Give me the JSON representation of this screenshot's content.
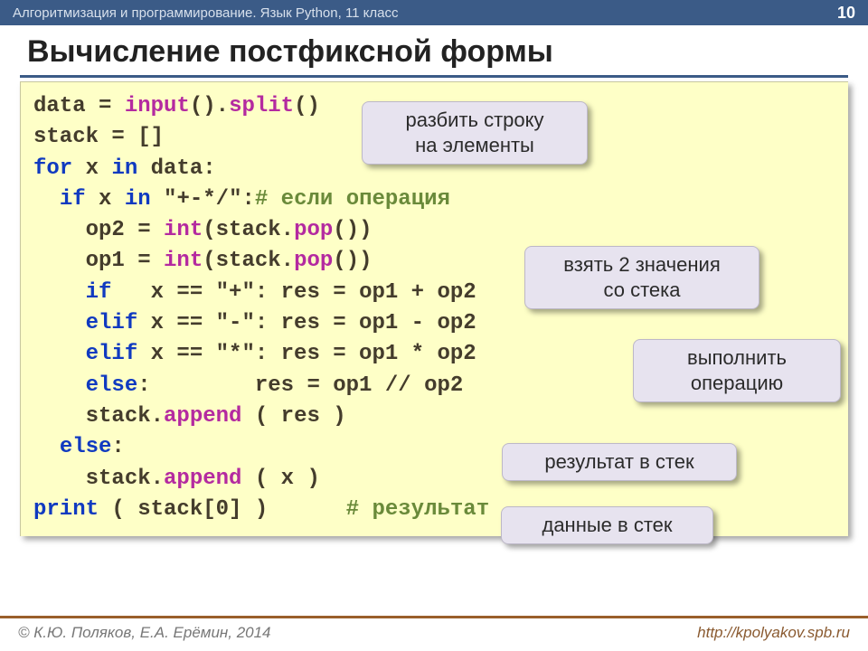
{
  "topbar": {
    "course": "Алгоритмизация и программирование. Язык Python, 11 класс",
    "page": "10"
  },
  "title": "Вычисление постфиксной формы",
  "code": {
    "l01a": "data = ",
    "l01b": "input",
    "l01c": "().",
    "l01d": "split",
    "l01e": "()",
    "l02": "stack = []",
    "l03a": "for",
    "l03b": " x ",
    "l03c": "in",
    "l03d": " data:",
    "l04a": "  ",
    "l04b": "if",
    "l04c": " x ",
    "l04d": "in",
    "l04e": " \"+-*/\":",
    "l04f": "# если операция",
    "l05a": "    op2 = ",
    "l05b": "int",
    "l05c": "(stack.",
    "l05d": "pop",
    "l05e": "())",
    "l06a": "    op1 = ",
    "l06b": "int",
    "l06c": "(stack.",
    "l06d": "pop",
    "l06e": "())",
    "l07a": "    ",
    "l07b": "if",
    "l07c": "   x == \"+\": res = op1 + op2",
    "l08a": "    ",
    "l08b": "elif",
    "l08c": " x == \"-\": res = op1 - op2",
    "l09a": "    ",
    "l09b": "elif",
    "l09c": " x == \"*\": res = op1 * op2",
    "l10a": "    ",
    "l10b": "else",
    "l10c": ":        res = op1 // op2",
    "l11a": "    stack.",
    "l11b": "append",
    "l11c": " ( res )",
    "l12a": "  ",
    "l12b": "else",
    "l12c": ":",
    "l13a": "    stack.",
    "l13b": "append",
    "l13c": " ( x )",
    "l14a": "print",
    "l14b": " ( stack[0] )      ",
    "l14c": "# результат"
  },
  "annot": {
    "a1": "разбить строку\nна элементы",
    "a2": "взять 2 значения\nсо стека",
    "a3": "выполнить\nоперацию",
    "a4": "результат в стек",
    "a5": "данные в стек"
  },
  "footer": {
    "authors": "© К.Ю. Поляков, Е.А. Ерёмин, 2014",
    "url": "http://kpolyakov.spb.ru"
  }
}
